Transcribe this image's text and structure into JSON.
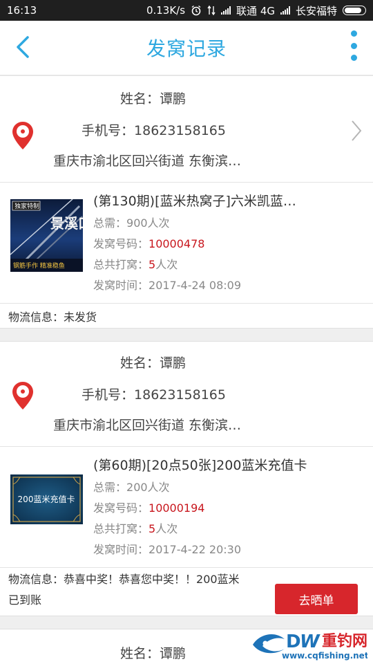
{
  "status_bar": {
    "time": "16:13",
    "speed": "0.13K/s",
    "carrier1": "联通 4G",
    "carrier2": "长安福特"
  },
  "header": {
    "title": "发窝记录"
  },
  "labels": {
    "name": "姓名：",
    "phone": "手机号：",
    "total_needed": "总需：",
    "code": "发窝号码：",
    "total_bets": "总共打窝：",
    "time": "发窝时间：",
    "logistics": "物流信息："
  },
  "records": [
    {
      "name": "谭鹏",
      "phone": "18623158165",
      "address": "重庆市渝北区回兴街道 东衡滨…",
      "prize_title": "(第130期)[蓝米热窝子]六米凯蓝…",
      "total_needed": "900人次",
      "code": "10000478",
      "total_bets_num": "5",
      "total_bets_unit": "人次",
      "time": "2017-4-24 08:09",
      "logistics": "未发货"
    },
    {
      "name": "谭鹏",
      "phone": "18623158165",
      "address": "重庆市渝北区回兴街道 东衡滨…",
      "prize_title": "(第60期)[20点50张]200蓝米充值卡",
      "total_needed": "200人次",
      "code": "10000194",
      "total_bets_num": "5",
      "total_bets_unit": "人次",
      "time": "2017-4-22 20:30",
      "logistics_line1": "恭喜中奖！恭喜您中奖！！200蓝米",
      "logistics_line2": "已到账",
      "share_label": "去晒单",
      "card_text": "200蓝米充值卡"
    },
    {
      "name": "谭鹏"
    }
  ],
  "thumb1": {
    "tag": "独家特制",
    "big": "景溪口",
    "bottom": "钢筋手作  精准稳鱼"
  },
  "watermark": {
    "brand": "重钓网",
    "url": "www.cqfishing.net"
  },
  "colors": {
    "accent": "#2ea8e0",
    "red": "#c8161d",
    "button": "#d7262c"
  }
}
